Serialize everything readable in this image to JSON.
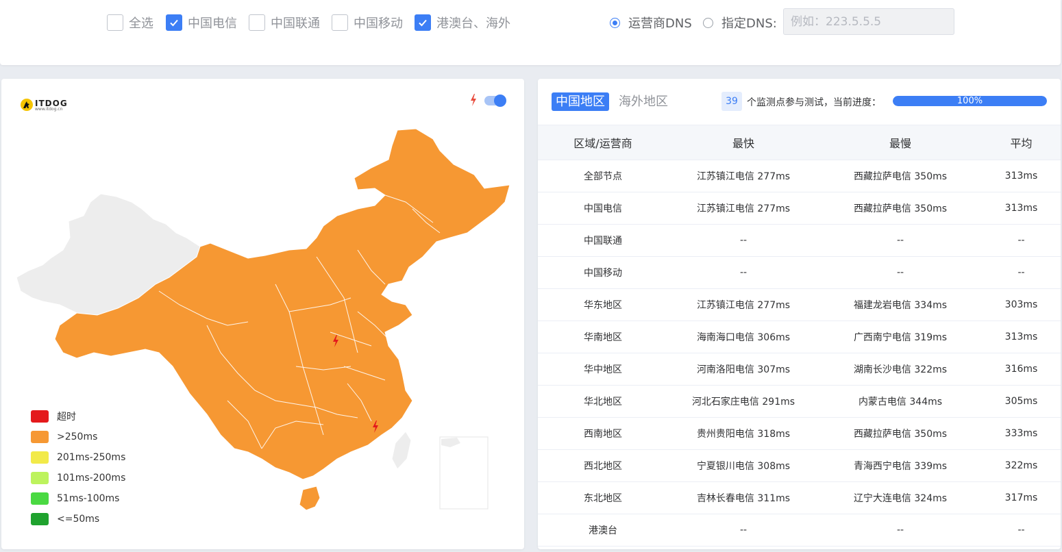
{
  "filters": {
    "checkboxes": [
      {
        "label": "全选",
        "checked": false
      },
      {
        "label": "中国电信",
        "checked": true
      },
      {
        "label": "中国联通",
        "checked": false
      },
      {
        "label": "中国移动",
        "checked": false
      },
      {
        "label": "港澳台、海外",
        "checked": true
      }
    ],
    "dns_mode": {
      "carrier_label": "运营商DNS",
      "custom_label": "指定DNS:",
      "selected": "carrier"
    },
    "dns_input": {
      "value": "",
      "placeholder": "例如：223.5.5.5"
    }
  },
  "map_panel": {
    "logo_text": "ITDOG",
    "logo_subtext": "www.itdog.cn",
    "toggle_on": true,
    "legend": [
      {
        "label": "超时",
        "color": "#e41a1c"
      },
      {
        "label": ">250ms",
        "color": "#f69833"
      },
      {
        "label": "201ms-250ms",
        "color": "#f2ea49"
      },
      {
        "label": "101ms-200ms",
        "color": "#bdf35d"
      },
      {
        "label": "51ms-100ms",
        "color": "#4ad942"
      },
      {
        "label": "<=50ms",
        "color": "#1fa22e"
      }
    ],
    "region_fill": "#f69833",
    "no_data_fill": "#ededed"
  },
  "result_panel": {
    "tabs": [
      {
        "label": "中国地区",
        "active": true
      },
      {
        "label": "海外地区",
        "active": false
      }
    ],
    "node_count": "39",
    "progress_label": "个监测点参与测试，当前进度：",
    "progress_value": 100,
    "progress_text": "100%",
    "table": {
      "headers": [
        "区域/运营商",
        "最快",
        "最慢",
        "平均"
      ],
      "rows": [
        [
          "全部节点",
          "江苏镇江电信 277ms",
          "西藏拉萨电信 350ms",
          "313ms"
        ],
        [
          "中国电信",
          "江苏镇江电信 277ms",
          "西藏拉萨电信 350ms",
          "313ms"
        ],
        [
          "中国联通",
          "--",
          "--",
          "--"
        ],
        [
          "中国移动",
          "--",
          "--",
          "--"
        ],
        [
          "华东地区",
          "江苏镇江电信 277ms",
          "福建龙岩电信 334ms",
          "303ms"
        ],
        [
          "华南地区",
          "海南海口电信 306ms",
          "广西南宁电信 319ms",
          "313ms"
        ],
        [
          "华中地区",
          "河南洛阳电信 307ms",
          "湖南长沙电信 322ms",
          "316ms"
        ],
        [
          "华北地区",
          "河北石家庄电信 291ms",
          "内蒙古电信 344ms",
          "305ms"
        ],
        [
          "西南地区",
          "贵州贵阳电信 318ms",
          "西藏拉萨电信 350ms",
          "333ms"
        ],
        [
          "西北地区",
          "宁夏银川电信 308ms",
          "青海西宁电信 339ms",
          "322ms"
        ],
        [
          "东北地区",
          "吉林长春电信 311ms",
          "辽宁大连电信 324ms",
          "317ms"
        ],
        [
          "港澳台",
          "--",
          "--",
          "--"
        ]
      ]
    }
  }
}
